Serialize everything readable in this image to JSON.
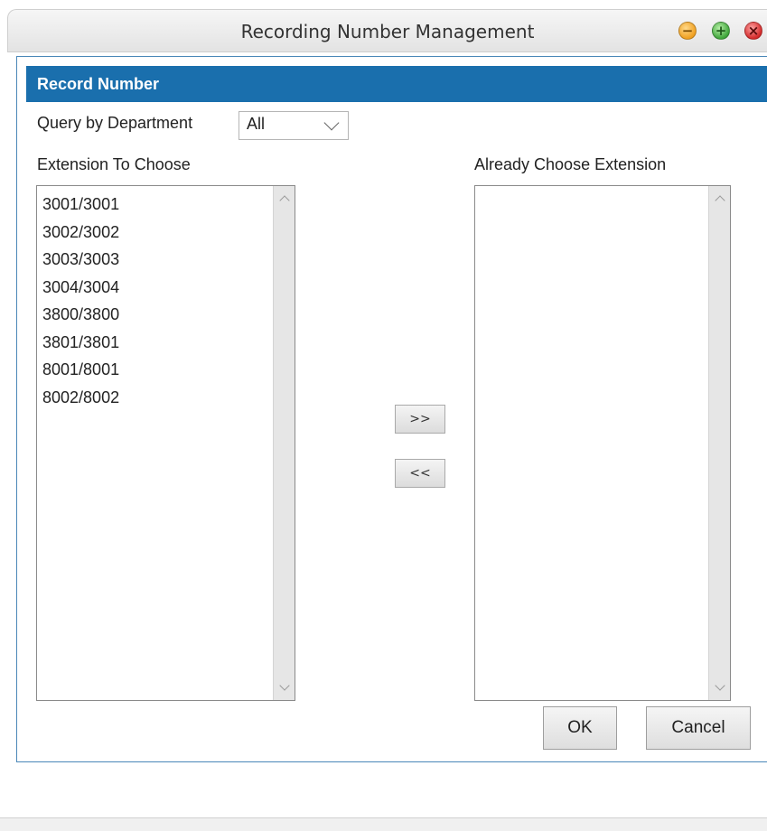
{
  "window": {
    "title": "Recording Number Management",
    "controls": {
      "minimize": "minimize-icon",
      "maximize": "maximize-icon",
      "close": "close-icon"
    }
  },
  "panel": {
    "header": "Record Number"
  },
  "query": {
    "label": "Query by Department",
    "selected": "All"
  },
  "left_list": {
    "caption": "Extension To Choose",
    "items": [
      "3001/3001",
      "3002/3002",
      "3003/3003",
      "3004/3004",
      "3800/3800",
      "3801/3801",
      "8001/8001",
      "8002/8002"
    ]
  },
  "right_list": {
    "caption": "Already Choose Extension",
    "items": []
  },
  "transfer": {
    "add_label": ">>",
    "remove_label": "<<"
  },
  "actions": {
    "ok_label": "OK",
    "cancel_label": "Cancel"
  },
  "colors": {
    "header_bg": "#1a6fad",
    "panel_border": "#4a87b8"
  }
}
